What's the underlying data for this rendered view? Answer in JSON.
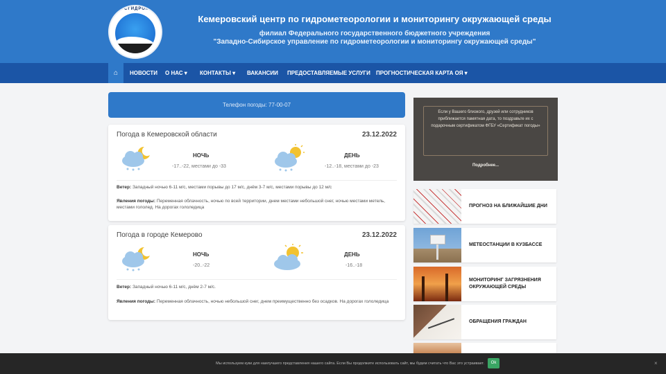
{
  "header": {
    "title": "Кемеровский центр по гидрометеорологии и мониторингу окружающей среды",
    "subtitle_line1": "филиал Федерального государственного бюджетного учреждения",
    "subtitle_line2": "\"Западно-Сибирское управление по гидрометеорологии и мониторингу окружающей среды\"",
    "logo_text": "РОСГИДРОМЕТ"
  },
  "nav": {
    "items": [
      {
        "label": "НОВОСТИ"
      },
      {
        "label": "О НАС ▾"
      },
      {
        "label": "КОНТАКТЫ ▾"
      },
      {
        "label": "ВАКАНСИИ"
      },
      {
        "label": "ПРЕДОСТАВЛЯЕМЫЕ УСЛУГИ"
      },
      {
        "label": "ПРОГНОСТИЧЕСКАЯ КАРТА ОЯ ▾"
      }
    ]
  },
  "phone": "Телефон погоды: 77-00-07",
  "cards": [
    {
      "title": "Погода в Кемеровской области",
      "date": "23.12.2022",
      "night_label": "НОЧЬ",
      "night_temp": "-17..-22, местами до -33",
      "day_label": "ДЕНЬ",
      "day_temp": "-12..-18, местами до -23",
      "wind_label": "Ветер:",
      "wind_text": "Западный ночью 6-11 м/с, местами порывы до 17 м/с, днём 3-7 м/с, местами порывы до 12 м/с",
      "events_label": "Явления погоды:",
      "events_text": "Переменная облачность, ночью по всей территории, днем местами небольшой снег, ночью местами метель, местами гололед. На дорогах гололедица"
    },
    {
      "title": "Погода в городе Кемерово",
      "date": "23.12.2022",
      "night_label": "НОЧЬ",
      "night_temp": "-20..-22",
      "day_label": "ДЕНЬ",
      "day_temp": "-16..-18",
      "wind_label": "Ветер:",
      "wind_text": "Западный ночью 6-11 м/с, днём 2-7 м/с.",
      "events_label": "Явления погоды:",
      "events_text": "Переменная облачность, ночью небольшой снег, днем преимущественно без осадков. На дорогах гололедица"
    }
  ],
  "promo": {
    "text": "Если у Вашего близкого, друзей или сотрудников приближается памятная дата, то поздравьте их с подарочным сертификатом ФГБУ «Сертификат погоды»",
    "link": "Подробнее..."
  },
  "sidebar": [
    {
      "label": "ПРОГНОЗ НА БЛИЖАЙШИЕ ДНИ"
    },
    {
      "label": "МЕТЕОСТАНЦИИ В КУЗБАССЕ"
    },
    {
      "label": "МОНИТОРИНГ ЗАГРЯЗНЕНИЯ ОКРУЖАЮЩЕЙ СРЕДЫ"
    },
    {
      "label": "ОБРАЩЕНИЯ ГРАЖДАН"
    }
  ],
  "cookie": {
    "text": "Мы используем куки для наилучшего представления нашего сайта. Если Вы продолжите использовать сайт, мы будем считать что Вас это устраивает.",
    "ok_label": "Ok",
    "close_label": "×"
  },
  "colors": {
    "header_blue": "#2f79c9",
    "nav_blue": "#1b55a6",
    "cookie_ok": "#3aa564"
  }
}
